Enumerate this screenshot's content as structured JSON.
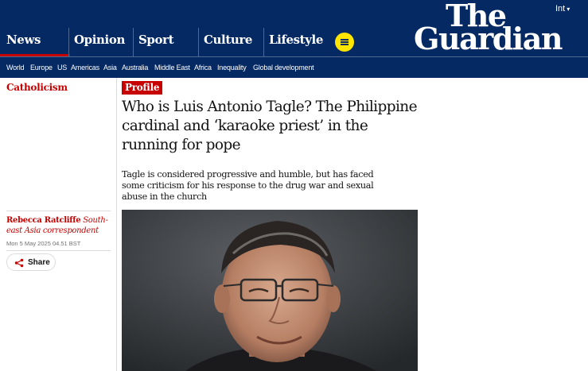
{
  "header": {
    "edition": "Int",
    "logo": {
      "line1": "The",
      "line2": "Guardian"
    },
    "pillars": [
      {
        "label": "News"
      },
      {
        "label": "Opinion"
      },
      {
        "label": "Sport"
      },
      {
        "label": "Culture"
      },
      {
        "label": "Lifestyle"
      }
    ],
    "subnav": [
      "World",
      "Europe",
      "US",
      "Americas",
      "Asia",
      "Australia",
      "Middle East",
      "Africa",
      "Inequality",
      "Global development"
    ]
  },
  "colors": {
    "brand": "#052962",
    "accent": "#c70000",
    "menu": "#ffe500"
  },
  "article": {
    "section": "Catholicism",
    "badge": "Profile",
    "headline": "Who is Luis Antonio Tagle? The Philippine cardinal and ‘karaoke priest’ in the running for pope",
    "standfirst": "Tagle is considered progressive and humble, but has faced some criticism for his response to the drug war and sexual abuse in the church",
    "author": "Rebecca Ratcliffe",
    "author_role": "South-east Asia correspondent",
    "date": "Mon 5 May 2025 04.51 BST",
    "share_label": "Share"
  },
  "icons": {
    "menu": "hamburger-icon",
    "share": "share-icon",
    "edition": "chevron-down-icon"
  }
}
